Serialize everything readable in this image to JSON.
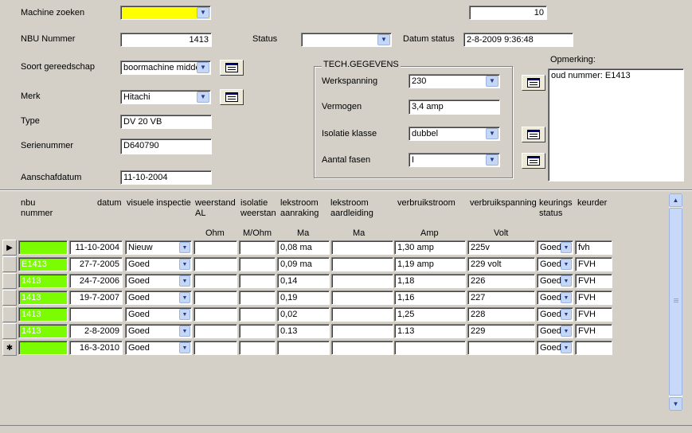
{
  "form": {
    "machine_zoeken_label": "Machine zoeken",
    "machine_zoeken_value": "",
    "count_value": "10",
    "nbu_nummer_label": "NBU Nummer",
    "nbu_nummer_value": "1413",
    "status_label": "Status",
    "status_value": "",
    "datum_status_label": "Datum status",
    "datum_status_value": "2-8-2009 9:36:48",
    "soort_label": "Soort gereedschap",
    "soort_value": "boormachine midde",
    "merk_label": "Merk",
    "merk_value": "Hitachi",
    "type_label": "Type",
    "type_value": "DV 20 VB",
    "serienummer_label": "Serienummer",
    "serienummer_value": "D640790",
    "aanschafdatum_label": "Aanschafdatum",
    "aanschafdatum_value": "11-10-2004",
    "opmerking_label": "Opmerking:",
    "opmerking_value": "oud nummer: E1413"
  },
  "tech": {
    "title": "TECH.GEGEVENS",
    "werkspanning_label": "Werkspanning",
    "werkspanning_value": "230",
    "vermogen_label": "Vermogen",
    "vermogen_value": "3,4 amp",
    "isolatie_label": "Isolatie klasse",
    "isolatie_value": "dubbel",
    "fasen_label": "Aantal fasen",
    "fasen_value": "I"
  },
  "grid": {
    "headers": {
      "nbu": "nbu\nnummer",
      "datum": "datum",
      "visuele": "visuele inspectie",
      "weerstand": "weerstand\nAL",
      "isolatie": "isolatie\nweerstan",
      "lekstroom_aanraking": "lekstroom\naanraking",
      "lekstroom_aardleiding": "lekstroom\naardleiding",
      "verbruikstroom": "verbruikstroom",
      "verbruikspanning": "verbruikspanning",
      "keurings": "keurings\nstatus",
      "keurder": "keurder"
    },
    "units": {
      "weerstand": "Ohm",
      "isolatie": "M/Ohm",
      "lekstroom_aanraking": "Ma",
      "lekstroom_aardleiding": "Ma",
      "verbruikstroom": "Amp",
      "verbruikspanning": "Volt"
    },
    "rows": [
      {
        "marker": "▶",
        "nbu": "",
        "datum": "11-10-2004",
        "visueel": "Nieuw",
        "weerstand": "",
        "isolatie": "",
        "aanraking": "0,08 ma",
        "aardleiding": "",
        "stroom": "1,30 amp",
        "spanning": "225v",
        "status": "Goed",
        "keurder": "fvh"
      },
      {
        "marker": "",
        "nbu": "E1413",
        "datum": "27-7-2005",
        "visueel": "Goed",
        "weerstand": "",
        "isolatie": "",
        "aanraking": "0,09 ma",
        "aardleiding": "",
        "stroom": "1,19 amp",
        "spanning": "229 volt",
        "status": "Goed",
        "keurder": "FVH"
      },
      {
        "marker": "",
        "nbu": "1413",
        "datum": "24-7-2006",
        "visueel": "Goed",
        "weerstand": "",
        "isolatie": "",
        "aanraking": "0,14",
        "aardleiding": "",
        "stroom": "1,18",
        "spanning": "226",
        "status": "Goed",
        "keurder": "FVH"
      },
      {
        "marker": "",
        "nbu": "1413",
        "datum": "19-7-2007",
        "visueel": "Goed",
        "weerstand": "",
        "isolatie": "",
        "aanraking": "0,19",
        "aardleiding": "",
        "stroom": "1,16",
        "spanning": "227",
        "status": "Goed",
        "keurder": "FVH"
      },
      {
        "marker": "",
        "nbu": "1413",
        "datum": "",
        "visueel": "Goed",
        "weerstand": "",
        "isolatie": "",
        "aanraking": "0,02",
        "aardleiding": "",
        "stroom": "1,25",
        "spanning": "228",
        "status": "Goed",
        "keurder": "FVH"
      },
      {
        "marker": "",
        "nbu": "1413",
        "datum": "2-8-2009",
        "visueel": "Goed",
        "weerstand": "",
        "isolatie": "",
        "aanraking": "0.13",
        "aardleiding": "",
        "stroom": "1.13",
        "spanning": "229",
        "status": "Goed",
        "keurder": "FVH"
      },
      {
        "marker": "✱",
        "nbu": "",
        "datum": "16-3-2010",
        "visueel": "Goed",
        "weerstand": "",
        "isolatie": "",
        "aanraking": "",
        "aardleiding": "",
        "stroom": "",
        "spanning": "",
        "status": "Goed",
        "keurder": ""
      }
    ]
  },
  "colors": {
    "highlight_yellow": "#ffff00",
    "nbu_green": "#7cfc00",
    "window_bg": "#d4d0c8"
  },
  "icons": {
    "combo": "chevron-down-icon",
    "form_button": "form-view-icon"
  }
}
